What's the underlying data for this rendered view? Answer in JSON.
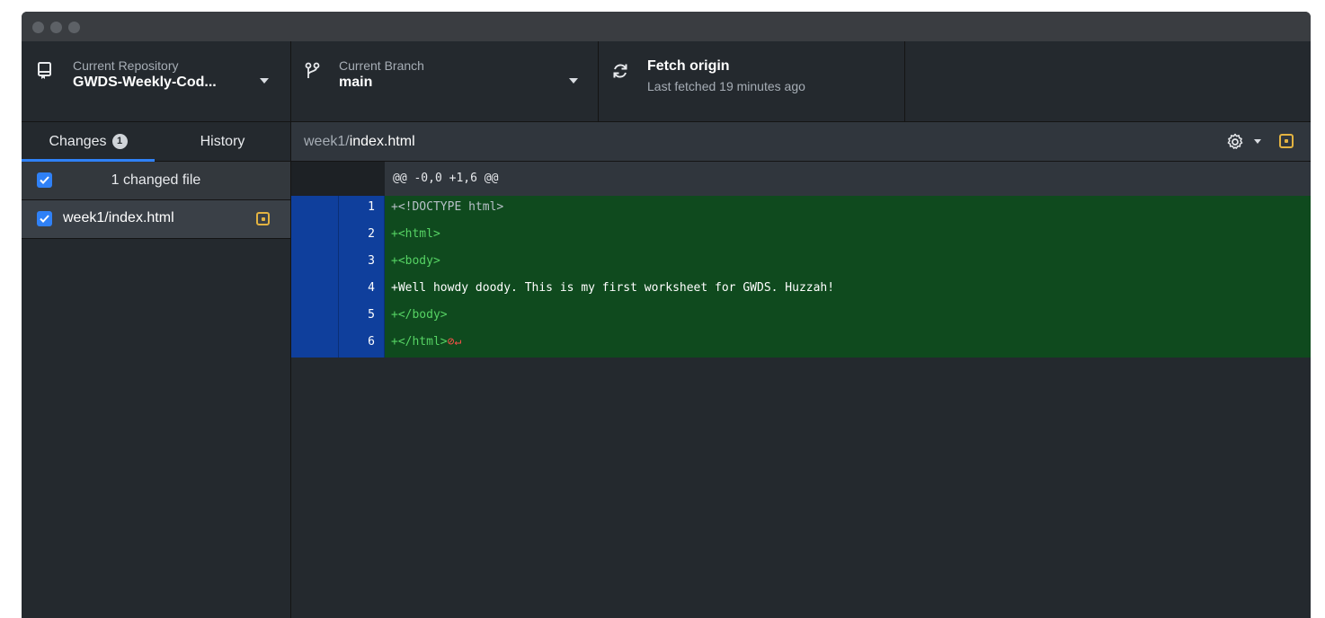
{
  "toolbar": {
    "repository": {
      "label": "Current Repository",
      "value": "GWDS-Weekly-Cod..."
    },
    "branch": {
      "label": "Current Branch",
      "value": "main"
    },
    "fetch": {
      "title": "Fetch origin",
      "subtitle": "Last fetched 19 minutes ago"
    }
  },
  "sidebar": {
    "tabs": [
      {
        "label": "Changes",
        "count": "1"
      },
      {
        "label": "History"
      }
    ],
    "changed_summary": "1 changed file",
    "files": [
      {
        "path": "week1/index.html",
        "status": "modified"
      }
    ]
  },
  "diff": {
    "file_dir": "week1/",
    "file_name": "index.html",
    "hunk_header": "@@ -0,0 +1,6 @@",
    "lines": [
      {
        "num": "1",
        "text": "+<!DOCTYPE html>"
      },
      {
        "num": "2",
        "text": "+<html>"
      },
      {
        "num": "3",
        "text": "+<body>"
      },
      {
        "num": "4",
        "text": "+Well howdy doody. This is my first worksheet for GWDS. Huzzah!"
      },
      {
        "num": "5",
        "text": "+</body>"
      },
      {
        "num": "6",
        "text": "+</html>",
        "no_newline_marker": "⊘↵"
      }
    ]
  },
  "colors": {
    "accent": "#2f81f7",
    "added_line_bg": "#0f4a1e",
    "gutter_bg": "#0f3f9c",
    "modified_icon": "#e3b341"
  }
}
